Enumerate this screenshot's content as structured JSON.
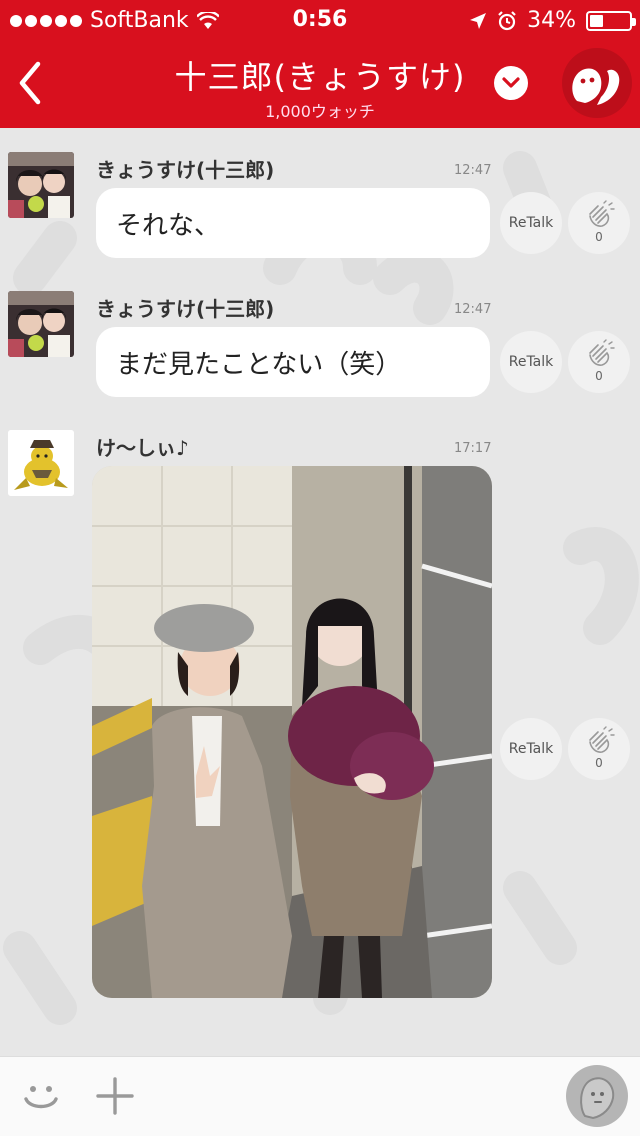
{
  "status_bar": {
    "carrier": "SoftBank",
    "time": "0:56",
    "battery": "34%",
    "battery_level": 0.34
  },
  "header": {
    "title": "十三郎(きょうすけ)",
    "subtitle": "1,000ウォッチ"
  },
  "messages": [
    {
      "sender": "きょうすけ(十三郎)",
      "time": "12:47",
      "text": "それな、",
      "retalk": "ReTalk",
      "claps": "0"
    },
    {
      "sender": "きょうすけ(十三郎)",
      "time": "12:47",
      "text": "まだ見たことない（笑）",
      "retalk": "ReTalk",
      "claps": "0"
    },
    {
      "sender": "け〜しぃ♪",
      "time": "17:17",
      "retalk": "ReTalk",
      "claps": "0"
    }
  ],
  "colors": {
    "brand_red": "#d8101e",
    "background": "#e7e7e7",
    "bubble": "#ffffff"
  },
  "icons": {
    "back": "chevron-left-icon",
    "dropdown": "chevron-down-icon",
    "profile": "ghost-mascot-icon",
    "clap": "clap-hand-icon",
    "emoji": "smiley-icon",
    "plus": "plus-icon",
    "talk": "talk-mascot-icon"
  }
}
